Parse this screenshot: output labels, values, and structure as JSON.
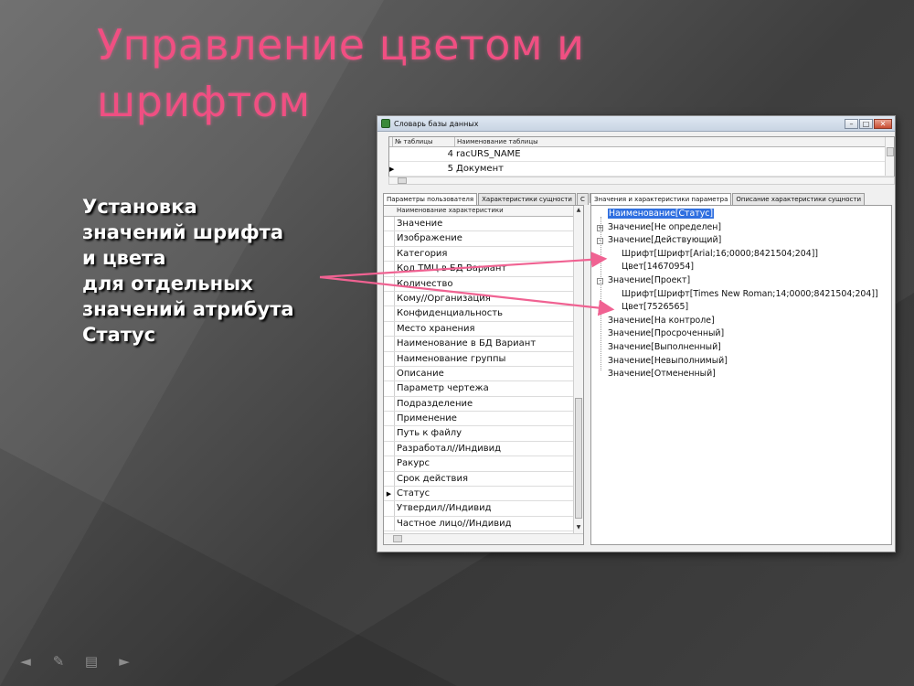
{
  "slide": {
    "title": "Управление цветом и шрифтом",
    "callout": [
      "Установка",
      "значений шрифта",
      "и цвета",
      "для отдельных",
      "значений атрибута",
      "Статус"
    ],
    "accent_color": "#f04f82",
    "arrow_color": "#f06292"
  },
  "window": {
    "title": "Словарь базы данных",
    "controls": [
      "minimize",
      "maximize",
      "close"
    ]
  },
  "tables_grid": {
    "headers": [
      "№ таблицы",
      "Наименование таблицы"
    ],
    "rows": [
      {
        "num": "4",
        "name": "racURS_NAME",
        "current": false
      },
      {
        "num": "5",
        "name": "Документ",
        "current": true
      }
    ]
  },
  "left_tabs": [
    "Параметры пользователя",
    "Характеристики сущности",
    "С"
  ],
  "left_list": {
    "header": "Наименование характеристики",
    "items": [
      "Значение",
      "Изображение",
      "Категория",
      "Код ТМЦ в БД Вариант",
      "Количество",
      "Кому//Организация",
      "Конфиденциальность",
      "Место хранения",
      "Наименование в БД Вариант",
      "Наименование группы",
      "Описание",
      "Параметр чертежа",
      "Подразделение",
      "Применение",
      "Путь к файлу",
      "Разработал//Индивид",
      "Ракурс",
      "Срок действия",
      "Статус",
      "Утвердил//Индивид",
      "Частное лицо//Индивид"
    ],
    "selected_index": 18
  },
  "right_tabs": [
    "Значения и характеристики параметра",
    "Описание характеристики сущности"
  ],
  "tree": {
    "root": "Наименование[Статус]",
    "nodes": [
      {
        "label": "Значение[Не определен]",
        "expander": "+",
        "children": []
      },
      {
        "label": "Значение[Действующий]",
        "expander": "-",
        "children": [
          "Шрифт[Шрифт[Arial;16;0000;8421504;204]]",
          "Цвет[14670954]"
        ]
      },
      {
        "label": "Значение[Проект]",
        "expander": "-",
        "children": [
          "Шрифт[Шрифт[Times New Roman;14;0000;8421504;204]]",
          "Цвет[7526565]"
        ]
      },
      {
        "label": "Значение[На контроле]",
        "expander": "",
        "children": []
      },
      {
        "label": "Значение[Просроченный]",
        "expander": "",
        "children": []
      },
      {
        "label": "Значение[Выполненный]",
        "expander": "",
        "children": []
      },
      {
        "label": "Значение[Невыполнимый]",
        "expander": "",
        "children": []
      },
      {
        "label": "Значение[Отмененный]",
        "expander": "",
        "children": []
      }
    ]
  },
  "nav_icons": [
    "back-arrow-icon",
    "pen-icon",
    "slides-menu-icon",
    "forward-arrow-icon"
  ]
}
